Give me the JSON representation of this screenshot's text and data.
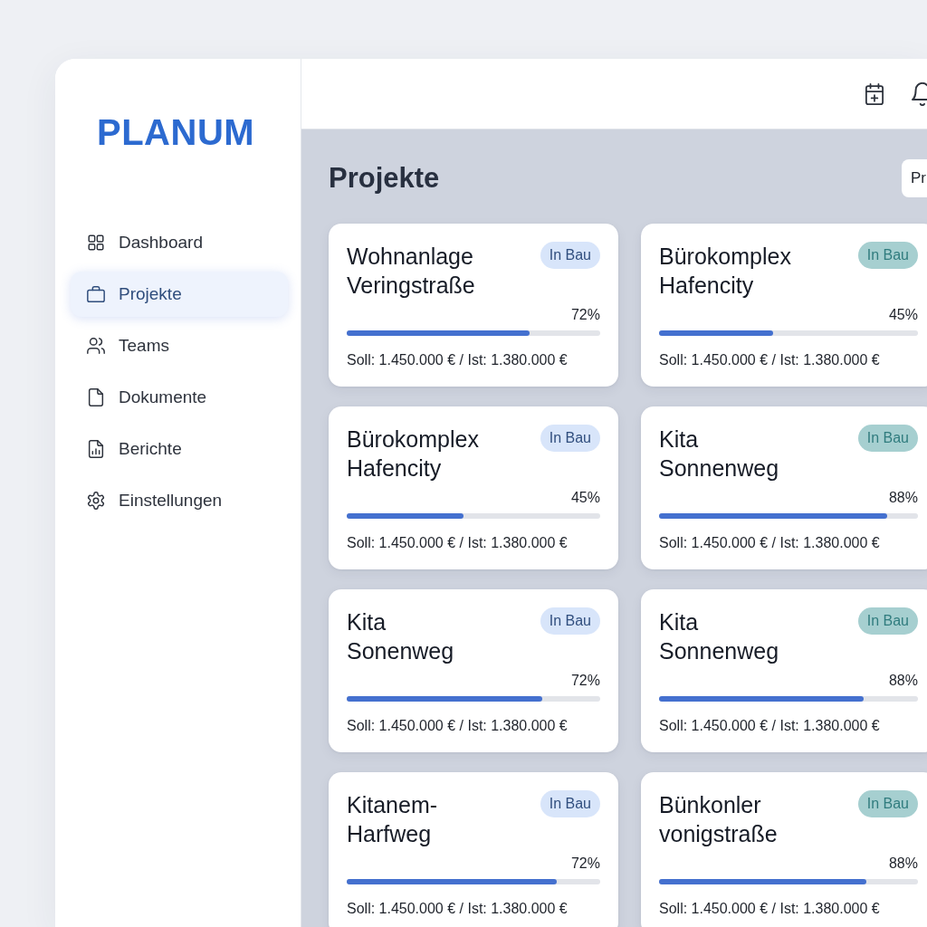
{
  "sidebar": {
    "logo": "PLANUM",
    "items": [
      {
        "label": "Dashboard",
        "selected": false
      },
      {
        "label": "Projekte",
        "selected": true
      },
      {
        "label": "Teams",
        "selected": false
      },
      {
        "label": "Dokumente",
        "selected": false
      },
      {
        "label": "Berichte",
        "selected": false
      },
      {
        "label": "Einstellungen",
        "selected": false
      }
    ]
  },
  "main": {
    "title": "Projekte",
    "action_button": "Pr"
  },
  "projects": [
    {
      "name": "Wohnanlage Veringstraße",
      "status": {
        "label": "In Bau",
        "color": "#d8e5fa"
      },
      "percent": "72%",
      "level": 0.72,
      "budget": "Soll: 1.450.000 € / Ist: 1.380.000 €"
    },
    {
      "name": "Bürokomplex Hafencity",
      "status": {
        "label": "In Bau",
        "color": "#a6cfd0"
      },
      "percent": "45%",
      "level": 0.44,
      "budget": "Soll: 1.450.000 € / Ist: 1.380.000 €"
    },
    {
      "name": "Bürokomplex Hafencity",
      "status": {
        "label": "In Bau",
        "color": "#d8e5fa"
      },
      "percent": "45%",
      "level": 0.46,
      "budget": "Soll: 1.450.000 € / Ist: 1.380.000 €"
    },
    {
      "name": "Kita Sonnenweg",
      "status": {
        "label": "In Bau",
        "color": "#a6cfd0"
      },
      "percent": "88%",
      "level": 0.88,
      "budget": "Soll: 1.450.000 € / Ist: 1.380.000 €"
    },
    {
      "name": "Kita Sonenweg",
      "status": {
        "label": "In Bau",
        "color": "#d8e5fa"
      },
      "percent": "72%",
      "level": 0.77,
      "budget": "Soll: 1.450.000 € / Ist: 1.380.000 €"
    },
    {
      "name": "Kita Sonnenweg",
      "status": {
        "label": "In Bau",
        "color": "#a6cfd0"
      },
      "percent": "88%",
      "level": 0.79,
      "budget": "Soll: 1.450.000 € / Ist: 1.380.000 €"
    },
    {
      "name": "Kitanem-Harfweg",
      "status": {
        "label": "In Bau",
        "color": "#d8e5fa"
      },
      "percent": "72%",
      "level": 0.83,
      "budget": "Soll: 1.450.000 € / Ist: 1.380.000 €"
    },
    {
      "name": "Bünkonler vonigstraße",
      "status": {
        "label": "In Bau",
        "color": "#a6cfd0"
      },
      "percent": "88%",
      "level": 0.8,
      "budget": "Soll: 1.450.000 € / Ist: 1.380.000 €"
    }
  ]
}
